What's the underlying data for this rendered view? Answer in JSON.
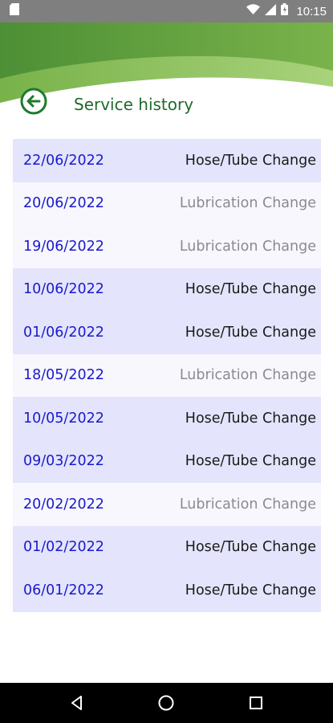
{
  "status_bar": {
    "time": "10:15",
    "icons": [
      "sd-card-icon",
      "wifi-icon",
      "signal-icon",
      "battery-icon"
    ]
  },
  "header": {
    "title": "Service history",
    "back_icon": "back-arrow-icon",
    "colors": {
      "primary_green": "#1f6b2a",
      "light_green": "#8fc15a"
    }
  },
  "history": [
    {
      "date": "22/06/2022",
      "type": "Hose/Tube Change"
    },
    {
      "date": "20/06/2022",
      "type": "Lubrication Change"
    },
    {
      "date": "19/06/2022",
      "type": "Lubrication Change"
    },
    {
      "date": "10/06/2022",
      "type": "Hose/Tube Change"
    },
    {
      "date": "01/06/2022",
      "type": "Hose/Tube Change"
    },
    {
      "date": "18/05/2022",
      "type": "Lubrication Change"
    },
    {
      "date": "10/05/2022",
      "type": "Hose/Tube Change"
    },
    {
      "date": "09/03/2022",
      "type": "Hose/Tube Change"
    },
    {
      "date": "20/02/2022",
      "type": "Lubrication Change"
    },
    {
      "date": "01/02/2022",
      "type": "Hose/Tube Change"
    },
    {
      "date": "06/01/2022",
      "type": "Hose/Tube Change"
    }
  ],
  "nav_bar": {
    "buttons": [
      "back-triangle-icon",
      "home-circle-icon",
      "recents-square-icon"
    ]
  }
}
